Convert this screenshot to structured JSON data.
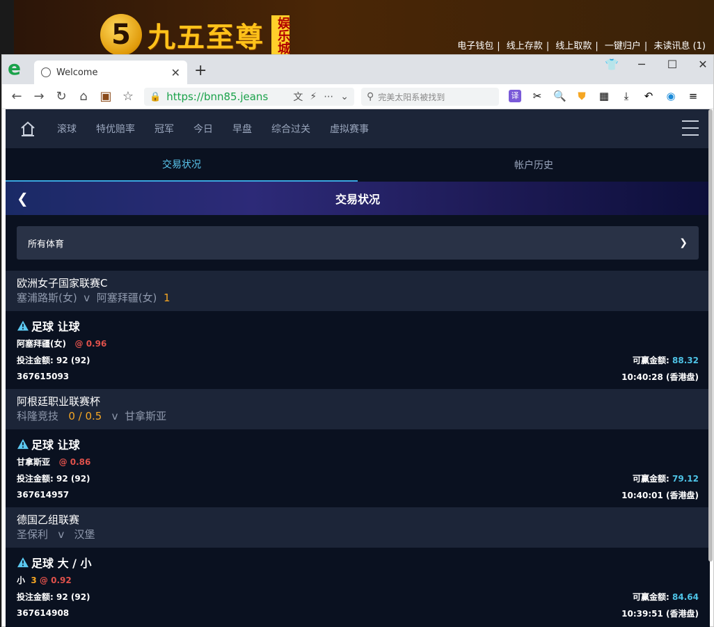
{
  "site": {
    "logo_mark": "5",
    "brand_name": "九五至尊",
    "brand_tag": "娱乐城",
    "links": [
      "电子钱包",
      "线上存款",
      "线上取款",
      "一键归户",
      "未读讯息 (1)"
    ],
    "colors": {
      "brand": "#ffc21a",
      "banner": "#4a2606"
    }
  },
  "browser": {
    "logo": "e",
    "tab_title": "Welcome",
    "url": "https://bnn85.jeans",
    "search_placeholder": "完美太阳系被找到",
    "ext_translate": "译",
    "icons": [
      "back-icon",
      "forward-icon",
      "reload-icon",
      "home-icon",
      "extension-icon",
      "favorites-icon",
      "translate-icon",
      "cut-icon",
      "search-icon",
      "shield-icon",
      "apps-icon",
      "download-icon",
      "undo-icon",
      "sync-icon",
      "menu-icon"
    ]
  },
  "nav": {
    "items": [
      "滚球",
      "特优赔率",
      "冠军",
      "今日",
      "早盘",
      "综合过关",
      "虚拟赛事"
    ]
  },
  "subtabs": [
    "交易状况",
    "帐户历史"
  ],
  "page_title": "交易状况",
  "filter": {
    "value": "所有体育"
  },
  "labels": {
    "stake": "投注金额:",
    "win": "可赢金额:",
    "v": "v"
  },
  "bets": [
    {
      "league": "欧洲女子国家联赛C",
      "home": "塞浦路斯(女)",
      "away": "阿塞拜疆(女)",
      "score": "1",
      "type": "足球 让球",
      "selection": "阿塞拜疆(女)",
      "line": "",
      "odds": "@ 0.96",
      "stake": "92 (92)",
      "win": "88.32",
      "id": "367615093",
      "time": "10:40:28 (香港盘)"
    },
    {
      "league": "阿根廷职业联赛杯",
      "home": "科隆竞技",
      "handicap": "0 / 0.5",
      "away": "甘拿斯亚",
      "type": "足球 让球",
      "selection": "甘拿斯亚",
      "line": "",
      "odds": "@ 0.86",
      "stake": "92 (92)",
      "win": "79.12",
      "id": "367614957",
      "time": "10:40:01 (香港盘)"
    },
    {
      "league": "德国乙组联赛",
      "home": "圣保利",
      "away": "汉堡",
      "type": "足球 大 / 小",
      "selection": "小",
      "line": "3",
      "odds": "@ 0.92",
      "stake": "92 (92)",
      "win": "84.64",
      "id": "367614908",
      "time": "10:39:51 (香港盘)"
    }
  ]
}
